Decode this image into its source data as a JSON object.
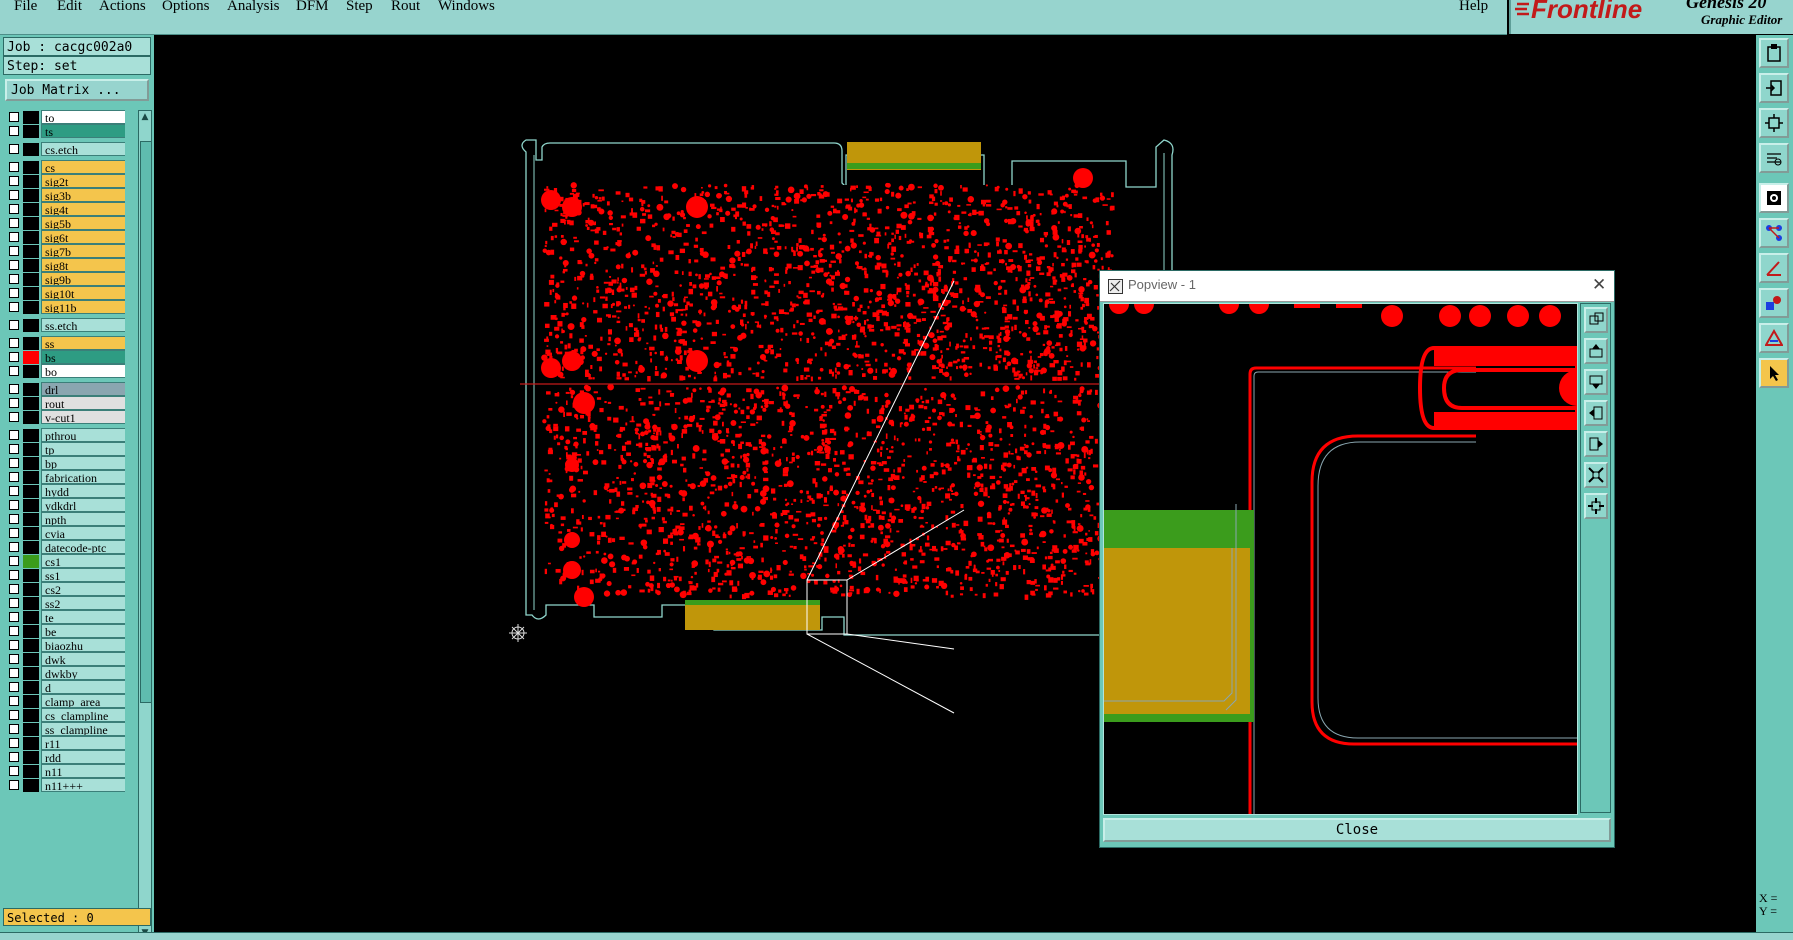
{
  "menu": {
    "items": [
      "File",
      "Edit",
      "Actions",
      "Options",
      "Analysis",
      "DFM",
      "Step",
      "Rout",
      "Windows"
    ],
    "help": "Help"
  },
  "brand": {
    "logo": "Frontline",
    "product": "Genesis 20",
    "subtitle": "Graphic Editor"
  },
  "job": {
    "job_label": "Job : cacgc002a0",
    "step_label": "Step: set",
    "job_matrix_button": "Job Matrix ..."
  },
  "layers": [
    {
      "name": "to",
      "bg": "#ffffff",
      "swatch": "#000000",
      "gap": 0
    },
    {
      "name": "ts",
      "bg": "#2e9c83",
      "swatch": "#000000",
      "gap": 0
    },
    {
      "name": "cs.etch",
      "bg": "#a8e0d8",
      "swatch": "#000000",
      "gap": 4
    },
    {
      "name": "cs",
      "bg": "#f4c54c",
      "swatch": "#000000",
      "gap": 4
    },
    {
      "name": "sig2t",
      "bg": "#f4c54c",
      "swatch": "#000000",
      "gap": 0
    },
    {
      "name": "sig3b",
      "bg": "#f4c54c",
      "swatch": "#000000",
      "gap": 0
    },
    {
      "name": "sig4t",
      "bg": "#f4c54c",
      "swatch": "#000000",
      "gap": 0
    },
    {
      "name": "sig5b",
      "bg": "#f4c54c",
      "swatch": "#000000",
      "gap": 0
    },
    {
      "name": "sig6t",
      "bg": "#f4c54c",
      "swatch": "#000000",
      "gap": 0
    },
    {
      "name": "sig7b",
      "bg": "#f4c54c",
      "swatch": "#000000",
      "gap": 0
    },
    {
      "name": "sig8t",
      "bg": "#f4c54c",
      "swatch": "#000000",
      "gap": 0
    },
    {
      "name": "sig9b",
      "bg": "#f4c54c",
      "swatch": "#000000",
      "gap": 0
    },
    {
      "name": "sig10t",
      "bg": "#f4c54c",
      "swatch": "#000000",
      "gap": 0
    },
    {
      "name": "sig11b",
      "bg": "#f4c54c",
      "swatch": "#000000",
      "gap": 0
    },
    {
      "name": "ss.etch",
      "bg": "#a8e0d8",
      "swatch": "#000000",
      "gap": 4
    },
    {
      "name": "ss",
      "bg": "#f4c54c",
      "swatch": "#000000",
      "gap": 4
    },
    {
      "name": "bs",
      "bg": "#2e9c83",
      "swatch": "#ff0000",
      "gap": 0
    },
    {
      "name": "bo",
      "bg": "#ffffff",
      "swatch": "#000000",
      "gap": 0
    },
    {
      "name": "drl",
      "bg": "#8aa6b0",
      "swatch": "#000000",
      "gap": 4
    },
    {
      "name": "rout",
      "bg": "#e0e0e0",
      "swatch": "#000000",
      "gap": 0
    },
    {
      "name": "v-cut1",
      "bg": "#e0e0e0",
      "swatch": "#000000",
      "gap": 0
    },
    {
      "name": "pthrou",
      "bg": "#a8e0d8",
      "swatch": "#000000",
      "gap": 4
    },
    {
      "name": "tp",
      "bg": "#a8e0d8",
      "swatch": "#000000",
      "gap": 0
    },
    {
      "name": "bp",
      "bg": "#a8e0d8",
      "swatch": "#000000",
      "gap": 0
    },
    {
      "name": "fabrication",
      "bg": "#a8e0d8",
      "swatch": "#000000",
      "gap": 0
    },
    {
      "name": "hydd",
      "bg": "#a8e0d8",
      "swatch": "#000000",
      "gap": 0
    },
    {
      "name": "ydkdrl",
      "bg": "#a8e0d8",
      "swatch": "#000000",
      "gap": 0
    },
    {
      "name": "npth",
      "bg": "#a8e0d8",
      "swatch": "#000000",
      "gap": 0
    },
    {
      "name": "cvia",
      "bg": "#a8e0d8",
      "swatch": "#000000",
      "gap": 0
    },
    {
      "name": "datecode-ptc",
      "bg": "#a8e0d8",
      "swatch": "#000000",
      "gap": 0
    },
    {
      "name": "cs1",
      "bg": "#a8e0d8",
      "swatch": "#3b9c1c",
      "gap": 0
    },
    {
      "name": "ss1",
      "bg": "#a8e0d8",
      "swatch": "#000000",
      "gap": 0
    },
    {
      "name": "cs2",
      "bg": "#a8e0d8",
      "swatch": "#000000",
      "gap": 0
    },
    {
      "name": "ss2",
      "bg": "#a8e0d8",
      "swatch": "#000000",
      "gap": 0
    },
    {
      "name": "te",
      "bg": "#a8e0d8",
      "swatch": "#000000",
      "gap": 0
    },
    {
      "name": "be",
      "bg": "#a8e0d8",
      "swatch": "#000000",
      "gap": 0
    },
    {
      "name": "biaozhu",
      "bg": "#a8e0d8",
      "swatch": "#000000",
      "gap": 0
    },
    {
      "name": "dwk",
      "bg": "#a8e0d8",
      "swatch": "#000000",
      "gap": 0
    },
    {
      "name": "dwkby",
      "bg": "#a8e0d8",
      "swatch": "#000000",
      "gap": 0
    },
    {
      "name": "d",
      "bg": "#a8e0d8",
      "swatch": "#000000",
      "gap": 0
    },
    {
      "name": "clamp_area",
      "bg": "#a8e0d8",
      "swatch": "#000000",
      "gap": 0
    },
    {
      "name": "cs_clampline",
      "bg": "#a8e0d8",
      "swatch": "#000000",
      "gap": 0
    },
    {
      "name": "ss_clampline",
      "bg": "#a8e0d8",
      "swatch": "#000000",
      "gap": 0
    },
    {
      "name": "r11",
      "bg": "#a8e0d8",
      "swatch": "#000000",
      "gap": 0
    },
    {
      "name": "rdd",
      "bg": "#a8e0d8",
      "swatch": "#000000",
      "gap": 0
    },
    {
      "name": "n11",
      "bg": "#a8e0d8",
      "swatch": "#000000",
      "gap": 0
    },
    {
      "name": "n11+++",
      "bg": "#a8e0d8",
      "swatch": "#000000",
      "gap": 0
    }
  ],
  "status": {
    "selected": "Selected : 0",
    "xy": "X =\nY ="
  },
  "popview": {
    "title": "Popview - 1",
    "close_button": "Close"
  },
  "colors": {
    "panel": "#6cc7b8",
    "menubar": "#97d4ce",
    "copper": "#ff0000",
    "outline": "#8fd6cc",
    "gold": "#c0960a",
    "green": "#3b9c1c"
  }
}
